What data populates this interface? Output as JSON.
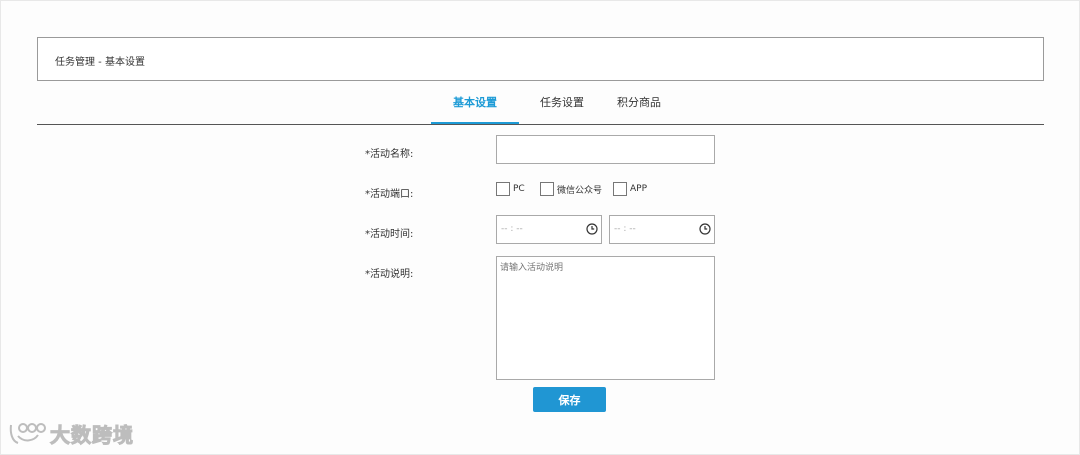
{
  "header": {
    "title": "任务管理 - 基本设置"
  },
  "tabs": [
    {
      "label": "基本设置",
      "active": true
    },
    {
      "label": "任务设置",
      "active": false
    },
    {
      "label": "积分商品",
      "active": false
    }
  ],
  "form": {
    "name_label": "*活动名称:",
    "name_value": "",
    "port_label": "*活动端口:",
    "ports": [
      {
        "label": "PC",
        "checked": false
      },
      {
        "label": "微信公众号",
        "checked": false
      },
      {
        "label": "APP",
        "checked": false
      }
    ],
    "time_label": "*活动时间:",
    "time_start_placeholder": "-- : --",
    "time_end_placeholder": "-- : --",
    "desc_label": "*活动说明:",
    "desc_placeholder": "请输入活动说明"
  },
  "save_label": "保存",
  "watermark": {
    "text": "大数跨境"
  },
  "colors": {
    "accent": "#1d9bd6",
    "button": "#2096d3"
  },
  "icons": {
    "time": "clock-icon"
  }
}
